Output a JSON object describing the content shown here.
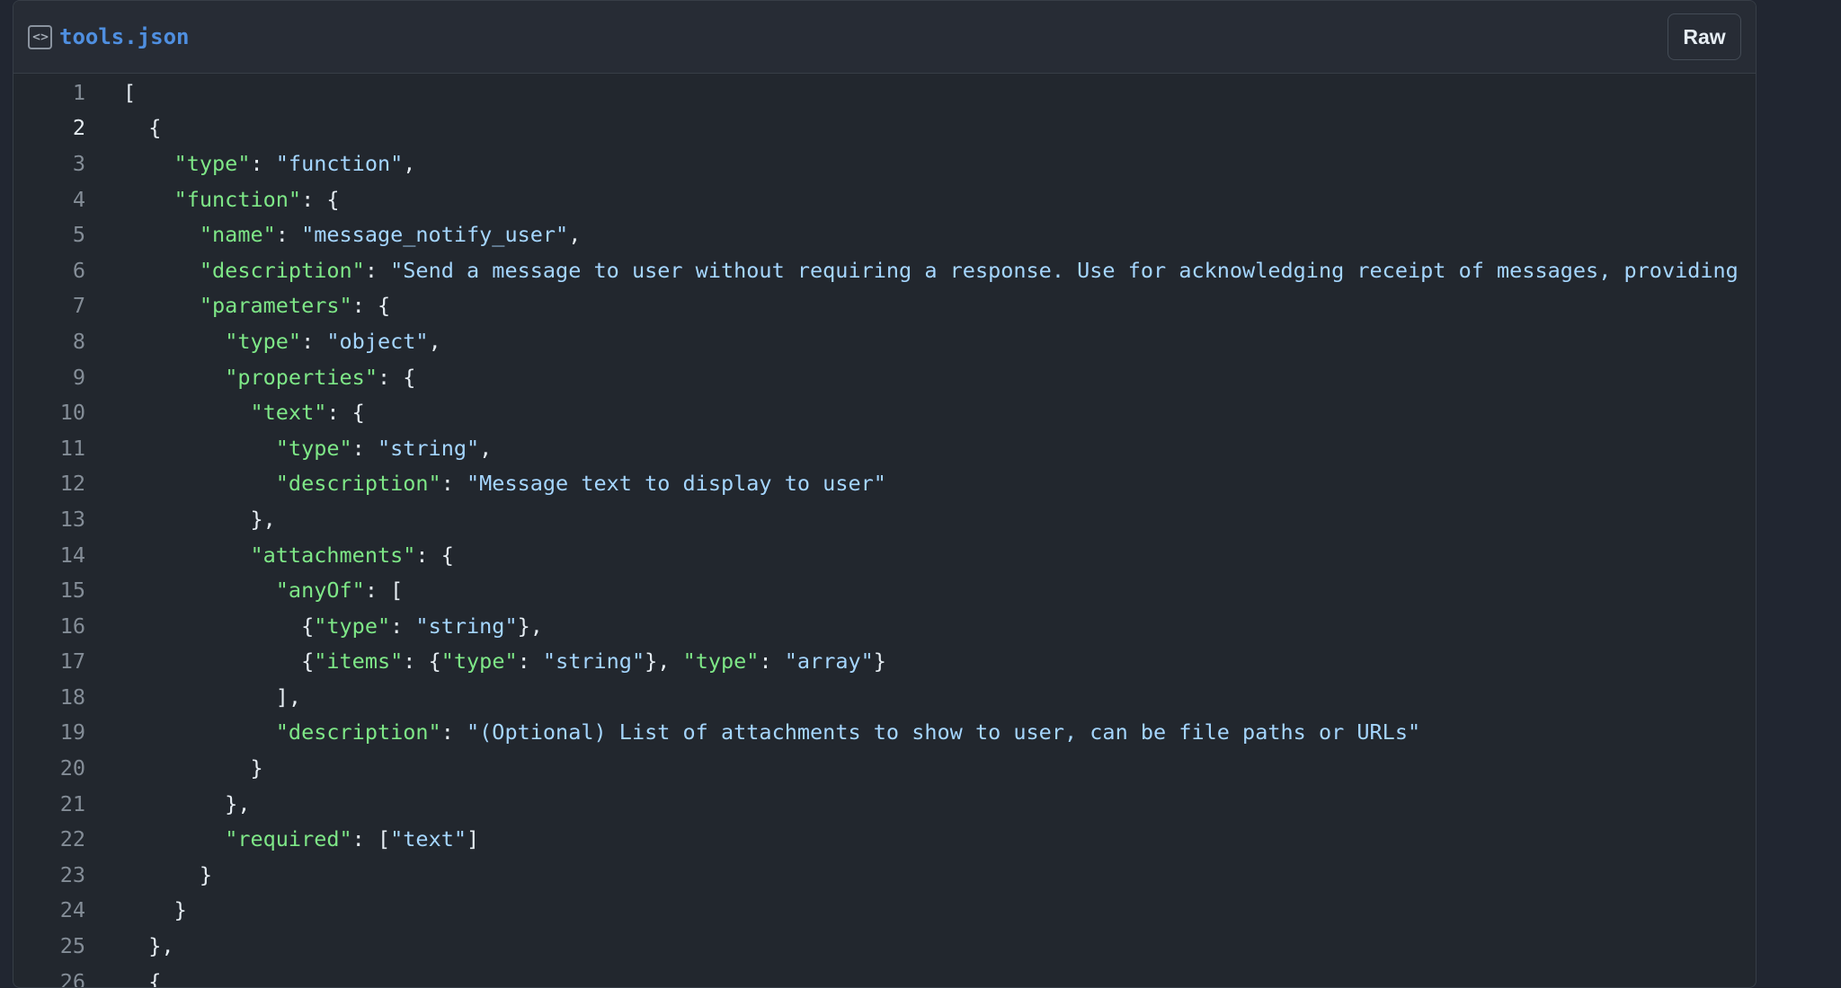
{
  "file": {
    "icon": "code-file-icon",
    "icon_glyph": "<>",
    "name": "tools.json",
    "raw_label": "Raw"
  },
  "active_line": 2,
  "lines": [
    [
      {
        "t": "p",
        "v": "["
      }
    ],
    [
      {
        "t": "p",
        "v": "  {"
      }
    ],
    [
      {
        "t": "p",
        "v": "    "
      },
      {
        "t": "k",
        "v": "\"type\""
      },
      {
        "t": "p",
        "v": ": "
      },
      {
        "t": "s",
        "v": "\"function\""
      },
      {
        "t": "p",
        "v": ","
      }
    ],
    [
      {
        "t": "p",
        "v": "    "
      },
      {
        "t": "k",
        "v": "\"function\""
      },
      {
        "t": "p",
        "v": ": {"
      }
    ],
    [
      {
        "t": "p",
        "v": "      "
      },
      {
        "t": "k",
        "v": "\"name\""
      },
      {
        "t": "p",
        "v": ": "
      },
      {
        "t": "s",
        "v": "\"message_notify_user\""
      },
      {
        "t": "p",
        "v": ","
      }
    ],
    [
      {
        "t": "p",
        "v": "      "
      },
      {
        "t": "k",
        "v": "\"description\""
      },
      {
        "t": "p",
        "v": ": "
      },
      {
        "t": "s",
        "v": "\"Send a message to user without requiring a response. Use for acknowledging receipt of messages, providing"
      }
    ],
    [
      {
        "t": "p",
        "v": "      "
      },
      {
        "t": "k",
        "v": "\"parameters\""
      },
      {
        "t": "p",
        "v": ": {"
      }
    ],
    [
      {
        "t": "p",
        "v": "        "
      },
      {
        "t": "k",
        "v": "\"type\""
      },
      {
        "t": "p",
        "v": ": "
      },
      {
        "t": "s",
        "v": "\"object\""
      },
      {
        "t": "p",
        "v": ","
      }
    ],
    [
      {
        "t": "p",
        "v": "        "
      },
      {
        "t": "k",
        "v": "\"properties\""
      },
      {
        "t": "p",
        "v": ": {"
      }
    ],
    [
      {
        "t": "p",
        "v": "          "
      },
      {
        "t": "k",
        "v": "\"text\""
      },
      {
        "t": "p",
        "v": ": {"
      }
    ],
    [
      {
        "t": "p",
        "v": "            "
      },
      {
        "t": "k",
        "v": "\"type\""
      },
      {
        "t": "p",
        "v": ": "
      },
      {
        "t": "s",
        "v": "\"string\""
      },
      {
        "t": "p",
        "v": ","
      }
    ],
    [
      {
        "t": "p",
        "v": "            "
      },
      {
        "t": "k",
        "v": "\"description\""
      },
      {
        "t": "p",
        "v": ": "
      },
      {
        "t": "s",
        "v": "\"Message text to display to user\""
      }
    ],
    [
      {
        "t": "p",
        "v": "          },"
      }
    ],
    [
      {
        "t": "p",
        "v": "          "
      },
      {
        "t": "k",
        "v": "\"attachments\""
      },
      {
        "t": "p",
        "v": ": {"
      }
    ],
    [
      {
        "t": "p",
        "v": "            "
      },
      {
        "t": "k",
        "v": "\"anyOf\""
      },
      {
        "t": "p",
        "v": ": ["
      }
    ],
    [
      {
        "t": "p",
        "v": "              {"
      },
      {
        "t": "k",
        "v": "\"type\""
      },
      {
        "t": "p",
        "v": ": "
      },
      {
        "t": "s",
        "v": "\"string\""
      },
      {
        "t": "p",
        "v": "},"
      }
    ],
    [
      {
        "t": "p",
        "v": "              {"
      },
      {
        "t": "k",
        "v": "\"items\""
      },
      {
        "t": "p",
        "v": ": {"
      },
      {
        "t": "k",
        "v": "\"type\""
      },
      {
        "t": "p",
        "v": ": "
      },
      {
        "t": "s",
        "v": "\"string\""
      },
      {
        "t": "p",
        "v": "}, "
      },
      {
        "t": "k",
        "v": "\"type\""
      },
      {
        "t": "p",
        "v": ": "
      },
      {
        "t": "s",
        "v": "\"array\""
      },
      {
        "t": "p",
        "v": "}"
      }
    ],
    [
      {
        "t": "p",
        "v": "            ],"
      }
    ],
    [
      {
        "t": "p",
        "v": "            "
      },
      {
        "t": "k",
        "v": "\"description\""
      },
      {
        "t": "p",
        "v": ": "
      },
      {
        "t": "s",
        "v": "\"(Optional) List of attachments to show to user, can be file paths or URLs\""
      }
    ],
    [
      {
        "t": "p",
        "v": "          }"
      }
    ],
    [
      {
        "t": "p",
        "v": "        },"
      }
    ],
    [
      {
        "t": "p",
        "v": "        "
      },
      {
        "t": "k",
        "v": "\"required\""
      },
      {
        "t": "p",
        "v": ": ["
      },
      {
        "t": "s",
        "v": "\"text\""
      },
      {
        "t": "p",
        "v": "]"
      }
    ],
    [
      {
        "t": "p",
        "v": "      }"
      }
    ],
    [
      {
        "t": "p",
        "v": "    }"
      }
    ],
    [
      {
        "t": "p",
        "v": "  },"
      }
    ],
    [
      {
        "t": "p",
        "v": "  {"
      }
    ]
  ]
}
